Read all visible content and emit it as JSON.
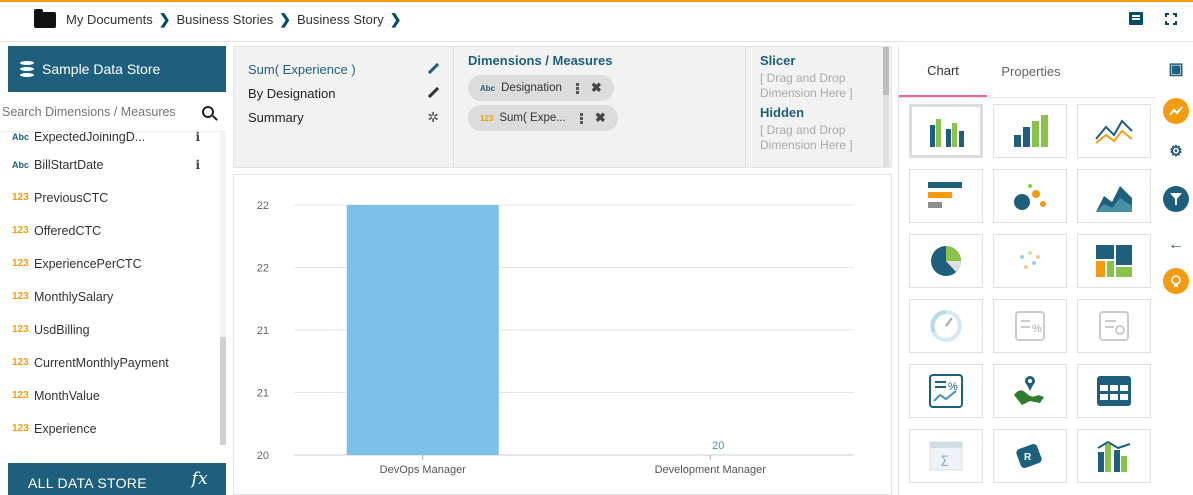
{
  "breadcrumb": {
    "items": [
      "My Documents",
      "Business Stories",
      "Business Story"
    ],
    "separator": "❯"
  },
  "sidebar": {
    "title": "Sample Data Store",
    "search_placeholder": "Search Dimensions / Measures",
    "fields": [
      {
        "type": "Abc",
        "name": "ExpectedJoiningD...",
        "info": "i"
      },
      {
        "type": "Abc",
        "name": "BillStartDate",
        "info": "i"
      },
      {
        "type": "123",
        "name": "PreviousCTC"
      },
      {
        "type": "123",
        "name": "OfferedCTC"
      },
      {
        "type": "123",
        "name": "ExperiencePerCTC"
      },
      {
        "type": "123",
        "name": "MonthlySalary"
      },
      {
        "type": "123",
        "name": "UsdBilling"
      },
      {
        "type": "123",
        "name": "CurrentMonthlyPayment"
      },
      {
        "type": "123",
        "name": "MonthValue"
      },
      {
        "type": "123",
        "name": "Experience"
      }
    ],
    "footer_label": "ALL DATA STORE",
    "footer_icon": "fx"
  },
  "config": {
    "title_line": "Sum( Experience )",
    "by_line": "By Designation",
    "summary_label": "Summary",
    "dims_title": "Dimensions / Measures",
    "chips": [
      {
        "type": "Abc",
        "label": "Designation"
      },
      {
        "type": "123",
        "label": "Sum( Expe..."
      }
    ],
    "slicer_title": "Slicer",
    "slicer_placeholder": "[ Drag and Drop Dimension Here ]",
    "hidden_title": "Hidden",
    "hidden_placeholder": "[ Drag and Drop Dimension Here ]"
  },
  "chart_data": {
    "type": "bar",
    "categories": [
      "DevOps Manager",
      "Development Manager"
    ],
    "values": [
      22,
      20
    ],
    "data_labels": [
      "",
      "20"
    ],
    "y_tick_labels": [
      "20",
      "21",
      "21",
      "22",
      "22"
    ],
    "ylim": [
      20,
      22
    ],
    "grid": true,
    "bar_color": "#7cbfe8"
  },
  "right_panel": {
    "tabs": [
      "Chart",
      "Properties"
    ],
    "active_tab": "Chart",
    "chart_types": [
      "clustered-bar-icon",
      "column-bar-icon",
      "line-chart-icon",
      "horizontal-bar-icon",
      "bubble-chart-icon",
      "area-chart-icon",
      "pie-chart-icon",
      "scatter-chart-icon",
      "treemap-icon",
      "gauge-icon",
      "kpi-percent-icon",
      "kpi-progress-icon",
      "trend-kpi-icon",
      "geo-map-icon",
      "data-grid-icon",
      "summation-icon",
      "r-chart-icon",
      "mixed-chart-icon"
    ]
  },
  "icon_strip": [
    "save-icon",
    "chart-icon",
    "settings-icon",
    "filter-icon",
    "back-icon",
    "bulb-icon"
  ],
  "colors": {
    "brand": "#1e5f7e",
    "accent": "#f39c12",
    "bar": "#7cbfe8"
  }
}
